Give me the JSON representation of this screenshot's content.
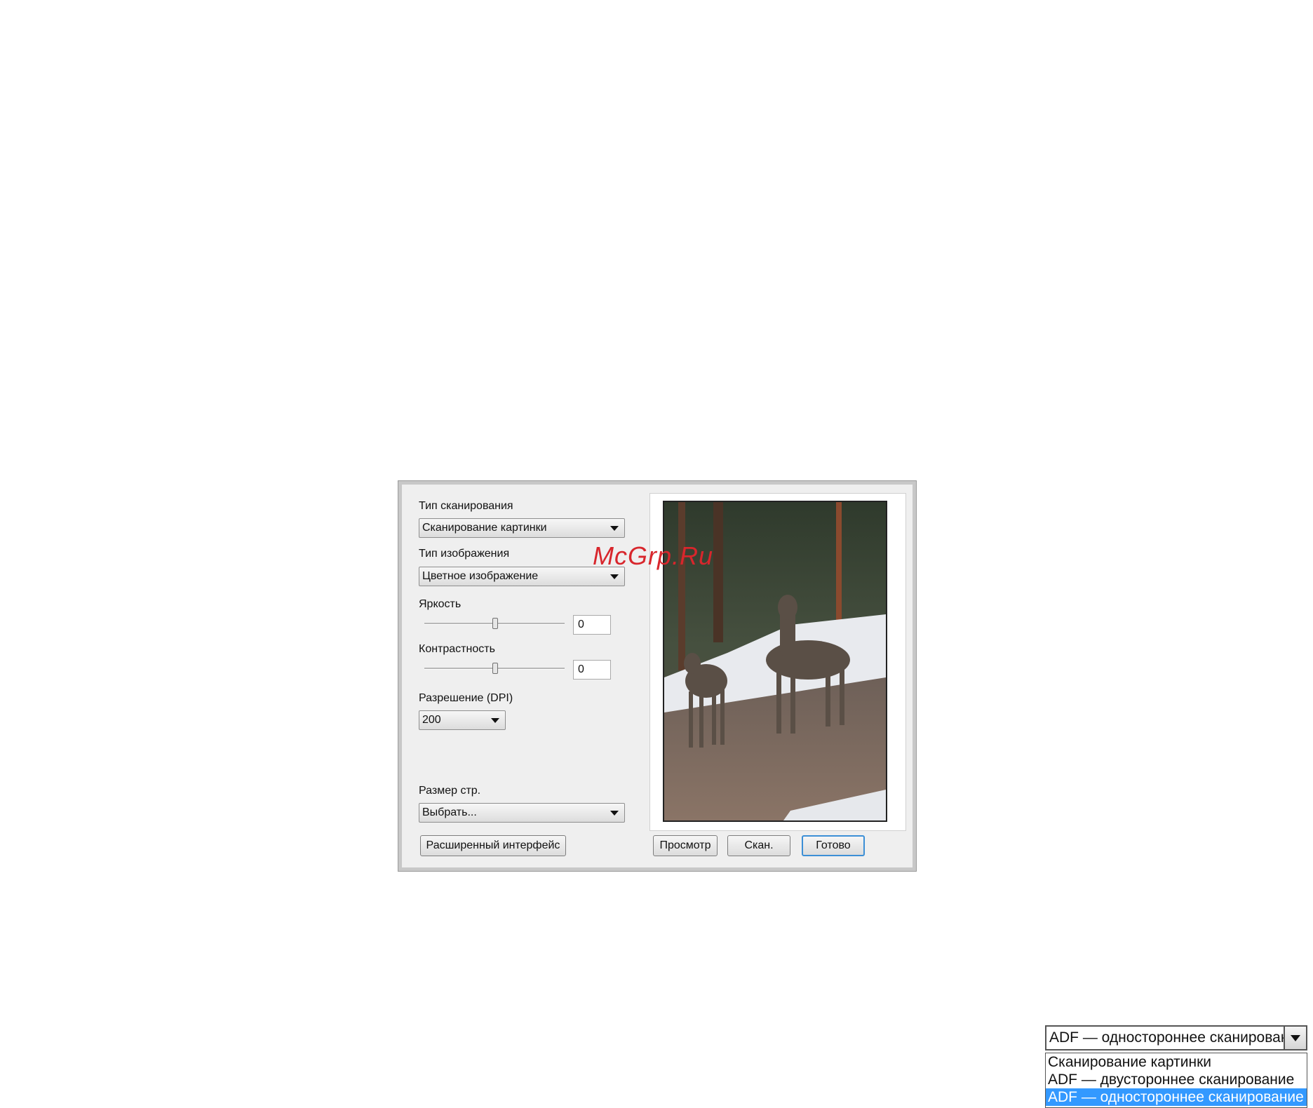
{
  "dialog": {
    "scan_type_label": "Тип сканирования",
    "scan_type_value": "Сканирование картинки",
    "image_type_label": "Тип изображения",
    "image_type_value": "Цветное изображение",
    "brightness_label": "Яркость",
    "brightness_value": "0",
    "brightness_level": 0.5,
    "contrast_label": "Контрастность",
    "contrast_value": "0",
    "contrast_level": 0.5,
    "resolution_label": "Разрешение (DPI)",
    "resolution_value": "200",
    "page_size_label": "Размер стр.",
    "page_size_value": "Выбрать...",
    "advanced_button": "Расширенный интерфейс",
    "preview_button": "Просмотр",
    "scan_button": "Скан.",
    "done_button": "Готово"
  },
  "watermark": "McGrp.Ru",
  "dropdown": {
    "selected": "ADF — одностороннее сканирование",
    "options": [
      "Сканирование картинки",
      "ADF — двустороннее сканирование",
      "ADF — одностороннее сканирование"
    ],
    "highlighted_index": 2
  },
  "colors": {
    "dialog_bg": "#efefef",
    "highlight": "#3399ff",
    "watermark": "#d8262c",
    "default_button_border": "#3c8fd6"
  }
}
